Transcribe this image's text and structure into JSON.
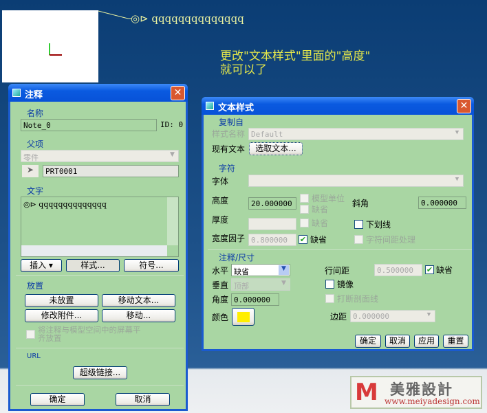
{
  "canvas": {
    "note_text": "◎⊳ qqqqqqqqqqqqqq",
    "hint_line1": "更改\"文本样式\"里面的\"高度\"",
    "hint_line2": "就可以了"
  },
  "note_dialog": {
    "title": "注释",
    "name_group": "名称",
    "name_value": "Note_0",
    "id_label": "ID: 0",
    "parent_group": "父项",
    "parent_type": "零件",
    "parent_value": "PRT0001",
    "text_group": "文字",
    "text_value": "◎⊳ qqqqqqqqqqqqqq",
    "insert": "插入 ▾",
    "style": "样式...",
    "symbol": "符号...",
    "placement_group": "放置",
    "unplaced": "未放置",
    "move_text": "移动文本...",
    "modify_attach": "修改附件...",
    "move": "移动...",
    "align_check": "将注释与模型空间中的屏幕平齐放置",
    "url_group": "URL",
    "hyperlink": "超级链接...",
    "ok": "确定",
    "cancel": "取消"
  },
  "style_dialog": {
    "title": "文本样式",
    "copy_group": "复制自",
    "style_name_label": "样式名称",
    "style_name_value": "Default",
    "existing_text_label": "现有文本",
    "select_text": "选取文本...",
    "char_group": "字符",
    "font_label": "字体",
    "font_value": "",
    "height_label": "高度",
    "height_value": "20.000000",
    "model_units": "模型单位",
    "default1": "缺省",
    "slant_label": "斜角",
    "slant_value": "0.000000",
    "thickness_label": "厚度",
    "thickness_value": "",
    "default2": "缺省",
    "underline": "下划线",
    "width_label": "宽度因子",
    "width_value": "0.800000",
    "default3": "缺省",
    "kerning": "字符间距处理",
    "note_group": "注释/尺寸",
    "horiz_label": "水平",
    "horiz_value": "缺省",
    "line_spacing_label": "行间距",
    "line_spacing_value": "0.500000",
    "default4": "缺省",
    "vert_label": "垂直",
    "vert_value": "顶部",
    "mirror": "镜像",
    "angle_label": "角度",
    "angle_value": "0.000000",
    "break_hatch": "打断剖面线",
    "color_label": "颜色",
    "color_value": "#ffee00",
    "margin_label": "边距",
    "margin_value": "0.000000",
    "ok": "确定",
    "cancel": "取消",
    "apply": "应用",
    "reset": "重置"
  },
  "watermark": {
    "brand": "美雅設計",
    "url": "www.meiyadesign.com"
  }
}
